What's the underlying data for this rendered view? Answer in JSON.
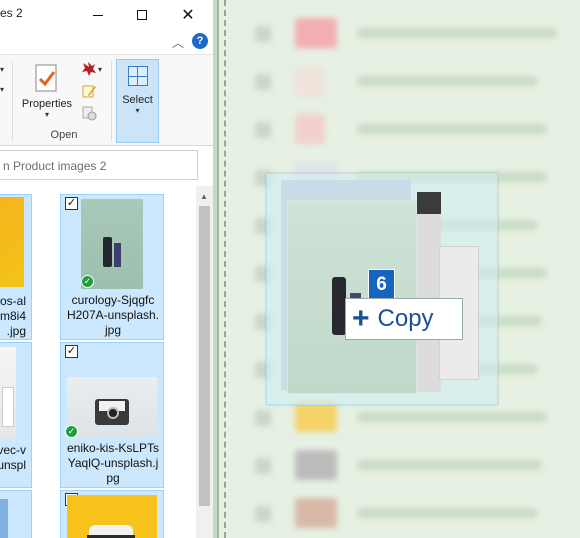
{
  "window": {
    "title_fragment": "es 2",
    "minimize_label": "",
    "maximize_label": "",
    "close_label": "✕"
  },
  "ribbon": {
    "collapse_glyph": "︿",
    "help_glyph": "?",
    "properties_label": "Properties",
    "open_group_label": "Open",
    "select_label": "Select",
    "caret": "▾"
  },
  "search": {
    "placeholder": "n Product images 2"
  },
  "files": [
    {
      "name": "os-al\nm8i4\n.jpg",
      "checked": true,
      "synced": false
    },
    {
      "name": "curology-SjqgfcH207A-unsplash.jpg",
      "label": "curology-Sjqgfc\nH207A-unsplash.\njpg",
      "checked": true,
      "synced": true
    },
    {
      "name": "vec-v\nunspl",
      "checked": true,
      "synced": false
    },
    {
      "name": "eniko-kis-KsLPTsYaqlQ-unsplash.jpg",
      "label": "eniko-kis-KsLPTs\nYaqlQ-unsplash.j\npg",
      "checked": true,
      "synced": true
    },
    {
      "name": "",
      "checked": true,
      "synced": false
    },
    {
      "name": "",
      "checked": true,
      "synced": false
    }
  ],
  "drag": {
    "count": "6",
    "operation_label": "Copy",
    "operation_glyph": "+"
  },
  "colors": {
    "selection": "#cce8ff",
    "selection_border": "#99d1ff",
    "accent_blue": "#1565c0",
    "sync_green": "#1f9e3a",
    "right_pane_bg": "#e6f1e3"
  },
  "icons": {
    "minimize": "minimize-icon",
    "maximize": "maximize-icon",
    "close": "close-icon",
    "help": "help-icon",
    "properties": "properties-icon",
    "select": "select-all-icon",
    "synced": "synced-checkmark-icon",
    "checkbox": "checkbox-icon",
    "copy": "plus-icon"
  }
}
